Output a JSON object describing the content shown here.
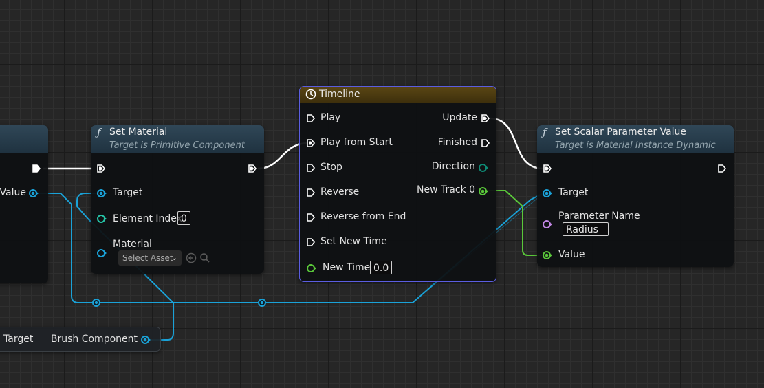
{
  "colors": {
    "object_wire": "#1aa2d8",
    "float_wire": "#5ac83a",
    "exec_wire": "#ffffff",
    "timeline_header": "#4e3d12",
    "function_header": "#2a4050",
    "timeline_border": "#5b5de0"
  },
  "left_node": {
    "pin_label": "Value"
  },
  "set_material": {
    "title": "Set Material",
    "subtitle": "Target is Primitive Component",
    "icon": "function-icon",
    "target_label": "Target",
    "element_index_label": "Element Index",
    "element_index_value": "0",
    "material_label": "Material",
    "material_asset": "Select Asset"
  },
  "timeline": {
    "title": "Timeline",
    "icon": "clock-icon",
    "inputs": [
      "Play",
      "Play from Start",
      "Stop",
      "Reverse",
      "Reverse from End",
      "Set New Time"
    ],
    "new_time_label": "New Time",
    "new_time_value": "0.0",
    "outputs": [
      "Update",
      "Finished",
      "Direction",
      "New Track 0"
    ]
  },
  "set_scalar": {
    "title": "Set Scalar Parameter Value",
    "subtitle": "Target is Material Instance Dynamic",
    "icon": "function-icon",
    "target_label": "Target",
    "param_label": "Parameter Name",
    "param_value": "Radius",
    "value_label": "Value"
  },
  "bottom_node": {
    "target_label": "Target",
    "output_label": "Brush Component"
  }
}
